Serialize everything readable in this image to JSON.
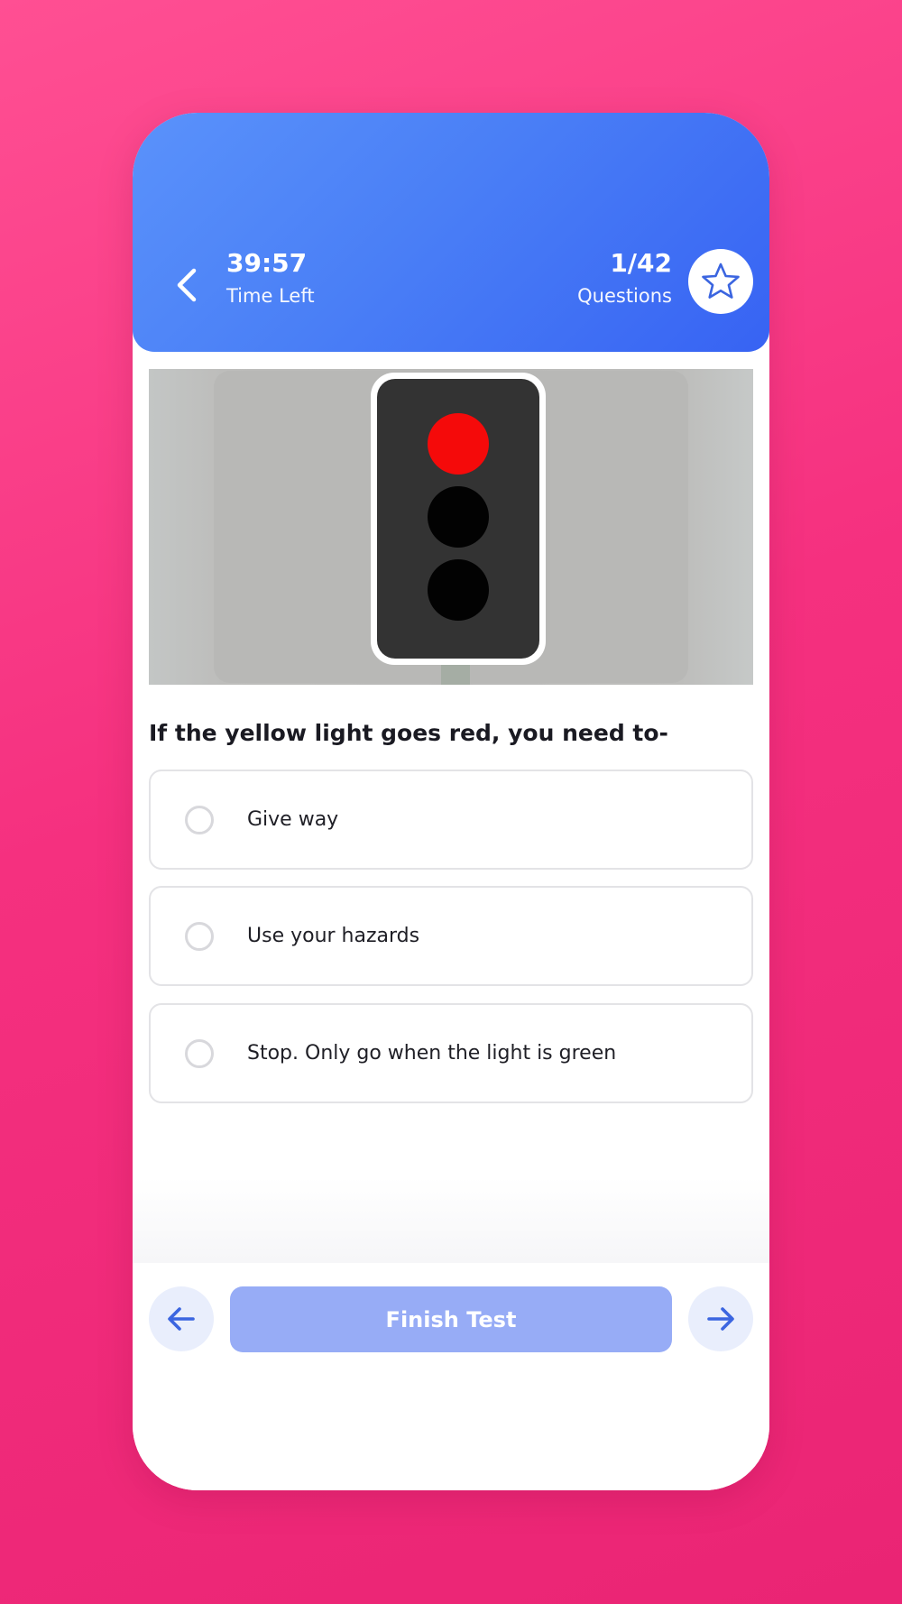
{
  "header": {
    "timer_value": "39:57",
    "timer_label": "Time Left",
    "progress_value": "1/42",
    "progress_label": "Questions",
    "back_icon": "chevron-left-icon",
    "bookmark_icon": "star-outline-icon"
  },
  "question": {
    "image_subject": "traffic-light-red",
    "text": "If the yellow light goes red, you need to-",
    "options": [
      {
        "label": "Give way",
        "selected": false
      },
      {
        "label": "Use your hazards",
        "selected": false
      },
      {
        "label": "Stop. Only go when the light is green",
        "selected": false
      }
    ]
  },
  "footer": {
    "finish_label": "Finish Test",
    "prev_icon": "arrow-left-icon",
    "next_icon": "arrow-right-icon"
  },
  "colors": {
    "background_pink": "#f5307f",
    "header_blue": "#4a7ff6",
    "accent_blue": "#3b65e0",
    "finish_button": "#97acf6",
    "nav_button_bg": "#e9eefc",
    "red_light": "#f50a0a"
  }
}
